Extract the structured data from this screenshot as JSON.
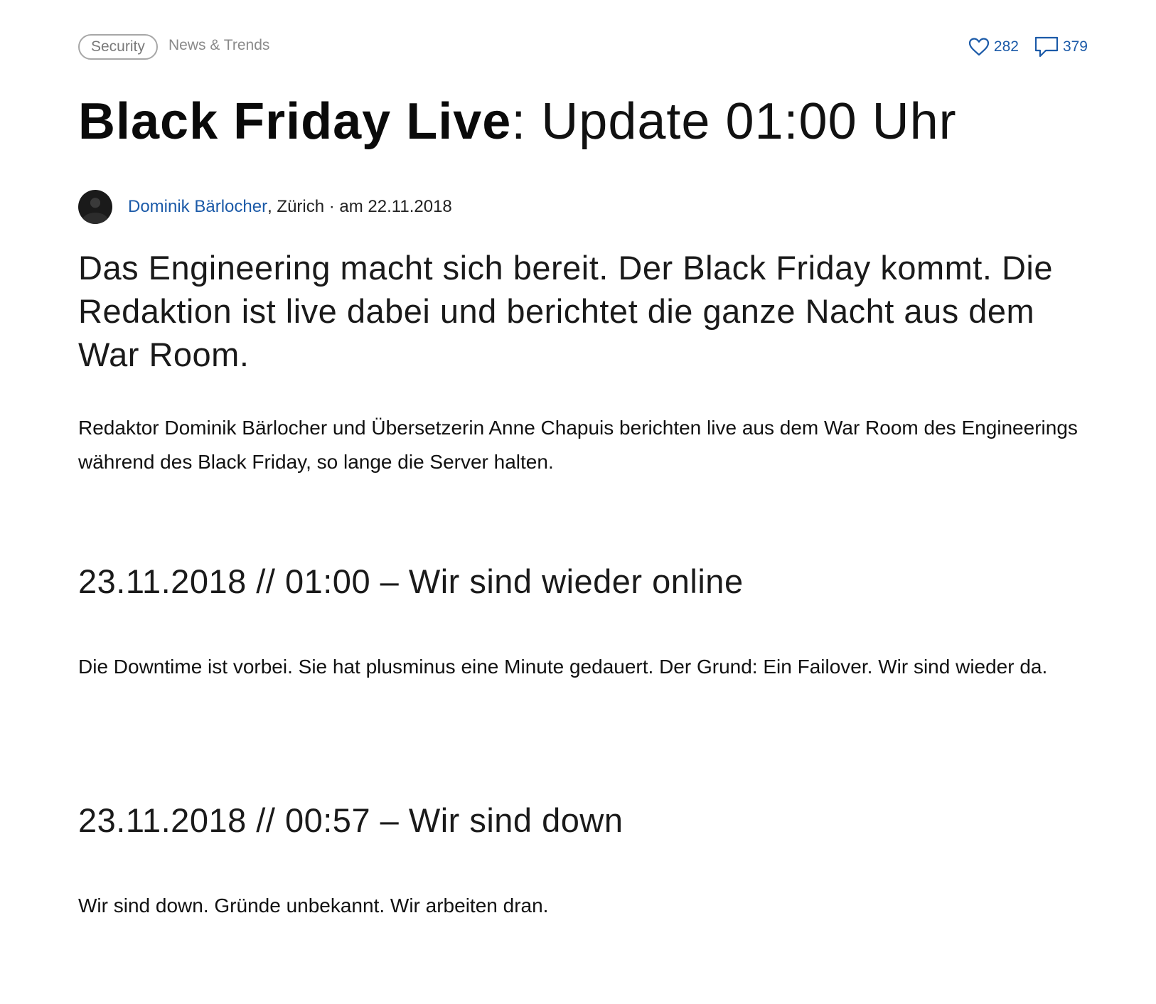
{
  "topbar": {
    "tag_label": "Security",
    "category_label": "News & Trends",
    "likes": "282",
    "comments": "379",
    "like_icon": "heart-icon",
    "comment_icon": "comment-icon"
  },
  "article": {
    "title_strong": "Black Friday Live",
    "title_rest": ": Update 01:00 Uhr",
    "author_name": "Dominik Bärlocher",
    "author_meta": ", Zürich · am 22.11.2018",
    "lead": "Das Engineering macht sich bereit. Der Black Friday kommt. Die Redaktion ist live dabei und berichtet die ganze Nacht aus dem War Room.",
    "intro": "Redaktor Dominik Bärlocher und Übersetzerin Anne Chapuis berichten live aus dem War Room des Engineerings während des Black Friday, so lange die Server halten.",
    "updates": [
      {
        "heading": "23.11.2018 // 01:00 – Wir sind wieder online",
        "body": "Die Downtime ist vorbei. Sie hat plusminus eine Minute gedauert. Der Grund: Ein Failover. Wir sind wieder da."
      },
      {
        "heading": "23.11.2018 // 00:57 – Wir sind down",
        "body": "Wir sind down. Gründe unbekannt. Wir arbeiten dran."
      }
    ]
  },
  "colors": {
    "link": "#1b5aa8",
    "text": "#111111",
    "tag_border": "#a7a7a7"
  }
}
